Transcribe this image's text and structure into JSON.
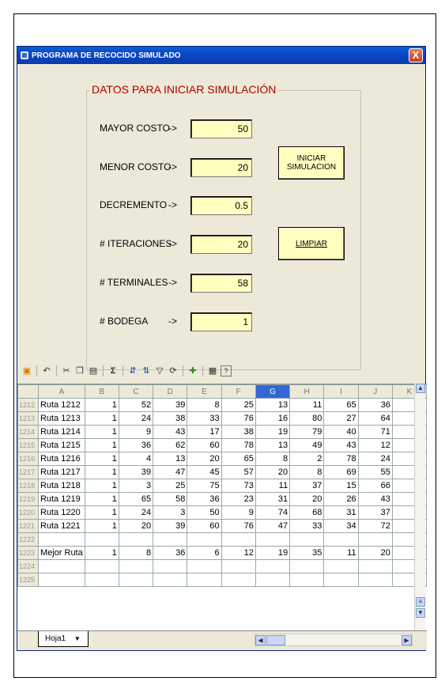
{
  "window": {
    "title": "PROGRAMA DE RECOCIDO SIMULADO",
    "close_glyph": "X"
  },
  "group": {
    "title": "DATOS PARA INICIAR SIMULACIÓN"
  },
  "params": [
    {
      "label": "MAYOR COSTO",
      "arrow": "->",
      "value": "50"
    },
    {
      "label": "MENOR COSTO",
      "arrow": "->",
      "value": "20"
    },
    {
      "label": "DECREMENTO",
      "arrow": "->",
      "value": "0.5"
    },
    {
      "label": "# ITERACIONES",
      "arrow": "->",
      "value": "20"
    },
    {
      "label": "# TERMINALES",
      "arrow": "->",
      "value": "58"
    },
    {
      "label": "# BODEGA",
      "arrow": "->",
      "value": "1"
    }
  ],
  "buttons": {
    "iniciar": "INICIAR\nSIMULACION",
    "limpiar": "LIMPIAR"
  },
  "toolbar": {
    "items": [
      "office-icon",
      "undo-icon",
      "cut-icon",
      "copy-icon",
      "paste-icon",
      "sum-icon",
      "sort-asc-icon",
      "sort-desc-icon",
      "filter-icon",
      "refresh-icon",
      "export-icon",
      "properties-icon",
      "help-icon"
    ],
    "sum_glyph": "Σ",
    "help_glyph": "?"
  },
  "sheet": {
    "columns": [
      "A",
      "B",
      "C",
      "D",
      "E",
      "F",
      "G",
      "H",
      "I",
      "J",
      "K"
    ],
    "selected_column": "G",
    "rows": [
      {
        "num": "1212",
        "cells": [
          "Ruta 1212",
          "1",
          "52",
          "39",
          "8",
          "25",
          "13",
          "11",
          "65",
          "36",
          ""
        ]
      },
      {
        "num": "1213",
        "cells": [
          "Ruta 1213",
          "1",
          "24",
          "38",
          "33",
          "76",
          "16",
          "80",
          "27",
          "64",
          ""
        ]
      },
      {
        "num": "1214",
        "cells": [
          "Ruta 1214",
          "1",
          "9",
          "43",
          "17",
          "38",
          "19",
          "79",
          "40",
          "71",
          ""
        ]
      },
      {
        "num": "1215",
        "cells": [
          "Ruta 1215",
          "1",
          "36",
          "62",
          "60",
          "78",
          "13",
          "49",
          "43",
          "12",
          ""
        ]
      },
      {
        "num": "1216",
        "cells": [
          "Ruta 1216",
          "1",
          "4",
          "13",
          "20",
          "65",
          "8",
          "2",
          "78",
          "24",
          ""
        ]
      },
      {
        "num": "1217",
        "cells": [
          "Ruta 1217",
          "1",
          "39",
          "47",
          "45",
          "57",
          "20",
          "8",
          "69",
          "55",
          ""
        ]
      },
      {
        "num": "1218",
        "cells": [
          "Ruta 1218",
          "1",
          "3",
          "25",
          "75",
          "73",
          "11",
          "37",
          "15",
          "66",
          ""
        ]
      },
      {
        "num": "1219",
        "cells": [
          "Ruta 1219",
          "1",
          "65",
          "58",
          "36",
          "23",
          "31",
          "20",
          "26",
          "43",
          ""
        ]
      },
      {
        "num": "1220",
        "cells": [
          "Ruta 1220",
          "1",
          "24",
          "3",
          "50",
          "9",
          "74",
          "68",
          "31",
          "37",
          ""
        ]
      },
      {
        "num": "1221",
        "cells": [
          "Ruta 1221",
          "1",
          "20",
          "39",
          "60",
          "76",
          "47",
          "33",
          "34",
          "72",
          ""
        ]
      },
      {
        "num": "1222",
        "cells": [
          "",
          "",
          "",
          "",
          "",
          "",
          "",
          "",
          "",
          "",
          ""
        ]
      },
      {
        "num": "1223",
        "cells": [
          "Mejor Ruta",
          "1",
          "8",
          "36",
          "6",
          "12",
          "19",
          "35",
          "11",
          "20",
          ""
        ]
      },
      {
        "num": "1224",
        "cells": [
          "",
          "",
          "",
          "",
          "",
          "",
          "",
          "",
          "",
          "",
          ""
        ]
      },
      {
        "num": "1225",
        "cells": [
          "",
          "",
          "",
          "",
          "",
          "",
          "",
          "",
          "",
          "",
          ""
        ]
      }
    ]
  },
  "sheet_tab": {
    "label": "Hoja1",
    "dropdown": "▼"
  }
}
